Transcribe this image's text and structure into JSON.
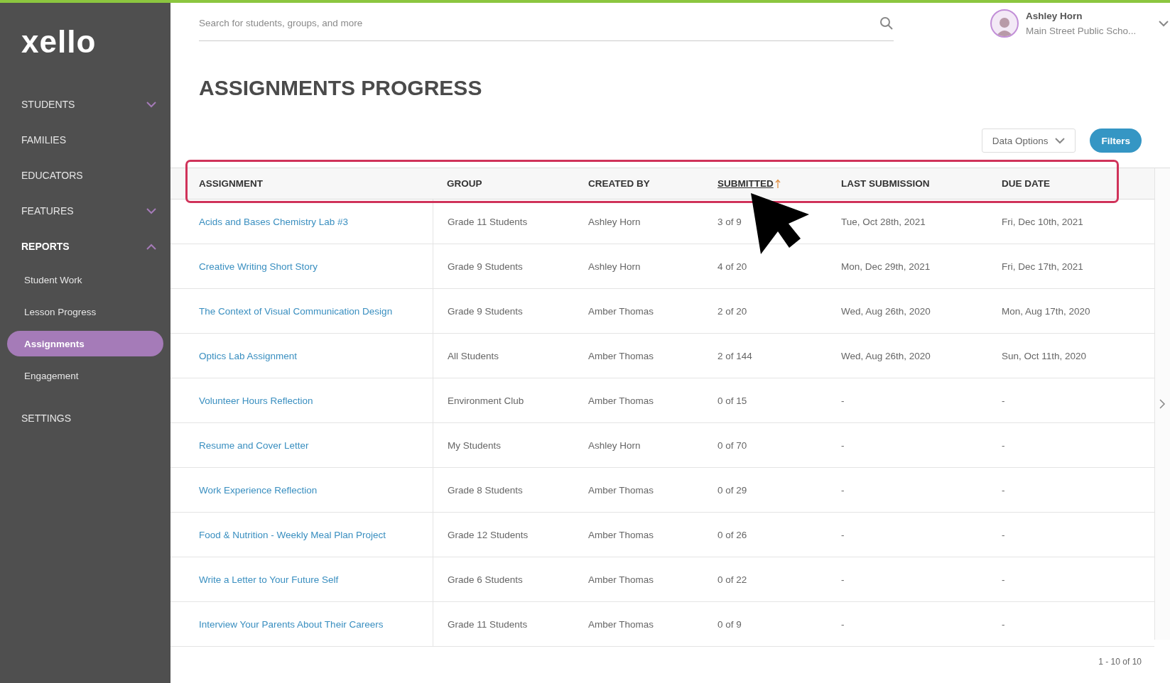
{
  "sidebar": {
    "logo": "xello",
    "items": [
      {
        "label": "STUDENTS",
        "kind": "group",
        "expanded": false
      },
      {
        "label": "FAMILIES",
        "kind": "link"
      },
      {
        "label": "EDUCATORS",
        "kind": "link"
      },
      {
        "label": "FEATURES",
        "kind": "group",
        "expanded": false
      },
      {
        "label": "REPORTS",
        "kind": "group",
        "expanded": true,
        "children": [
          {
            "label": "Student Work",
            "selected": false
          },
          {
            "label": "Lesson Progress",
            "selected": false
          },
          {
            "label": "Assignments",
            "selected": true
          },
          {
            "label": "Engagement",
            "selected": false
          }
        ]
      },
      {
        "label": "SETTINGS",
        "kind": "link"
      }
    ]
  },
  "header": {
    "search": {
      "placeholder": "Search for students, groups, and more"
    },
    "user": {
      "name": "Ashley Horn",
      "school": "Main Street Public Scho..."
    }
  },
  "title": "ASSIGNMENTS PROGRESS",
  "toolbar": {
    "data_options": "Data Options",
    "filters": "Filters"
  },
  "table": {
    "columns": [
      {
        "label": "ASSIGNMENT",
        "sorted": false
      },
      {
        "label": "GROUP",
        "sorted": false
      },
      {
        "label": "CREATED BY",
        "sorted": false
      },
      {
        "label": "SUBMITTED",
        "sorted": true
      },
      {
        "label": "LAST SUBMISSION",
        "sorted": false
      },
      {
        "label": "DUE DATE",
        "sorted": false
      }
    ],
    "rows": [
      [
        "Acids and Bases Chemistry Lab #3",
        "Grade 11 Students",
        "Ashley Horn",
        "3 of 9",
        "Tue, Oct 28th, 2021",
        "Fri, Dec 10th, 2021"
      ],
      [
        "Creative Writing Short Story",
        "Grade 9 Students",
        "Ashley Horn",
        "4 of 20",
        "Mon, Dec 29th, 2021",
        "Fri, Dec 17th, 2021"
      ],
      [
        "The Context of Visual Communication Design",
        "Grade 9 Students",
        "Amber Thomas",
        "2 of 20",
        "Wed, Aug 26th, 2020",
        "Mon, Aug 17th, 2020"
      ],
      [
        "Optics Lab Assignment",
        "All Students",
        "Amber Thomas",
        "2 of 144",
        "Wed, Aug 26th, 2020",
        "Sun, Oct 11th, 2020"
      ],
      [
        "Volunteer Hours Reflection",
        "Environment Club",
        "Amber Thomas",
        "0 of 15",
        "-",
        "-"
      ],
      [
        "Resume and Cover Letter",
        "My Students",
        "Ashley Horn",
        "0 of 70",
        "-",
        "-"
      ],
      [
        "Work Experience Reflection",
        "Grade 8 Students",
        "Amber Thomas",
        "0 of 29",
        "-",
        "-"
      ],
      [
        "Food & Nutrition - Weekly Meal Plan Project",
        "Grade 12 Students",
        "Amber Thomas",
        "0 of 26",
        "-",
        "-"
      ],
      [
        "Write a Letter to Your Future Self",
        "Grade 6 Students",
        "Amber Thomas",
        "0 of 22",
        "-",
        "-"
      ],
      [
        "Interview Your Parents About Their Careers",
        "Grade 11 Students",
        "Amber Thomas",
        "0 of 9",
        "-",
        "-"
      ]
    ],
    "pagination": "1 - 10 of 10"
  },
  "annotations": {
    "header_highlight": true,
    "cursor": true
  }
}
